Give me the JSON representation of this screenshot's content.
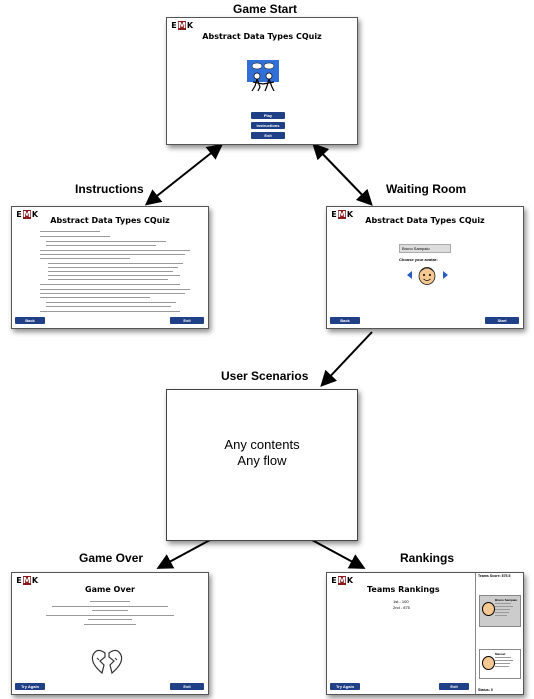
{
  "labels": {
    "game_start": "Game Start",
    "instructions": "Instructions",
    "waiting_room": "Waiting Room",
    "user_scenarios": "User Scenarios",
    "game_over": "Game Over",
    "rankings": "Rankings"
  },
  "logo": {
    "left": "E",
    "middle": "M",
    "right": "K"
  },
  "game_start": {
    "title": "Abstract Data Types CQuiz",
    "buttons": [
      "Play",
      "Instructions",
      "Exit"
    ]
  },
  "instructions": {
    "title": "Abstract Data Types CQuiz",
    "back": "Back",
    "exit": "Exit"
  },
  "waiting_room": {
    "title": "Abstract Data Types CQuiz",
    "name_value": "Bruno Sampaio",
    "avatar_label": "Choose your avatar:",
    "back": "Back",
    "start": "Start"
  },
  "user_scenarios": {
    "line1": "Any contents",
    "line2": "Any flow"
  },
  "game_over": {
    "title": "Game Over",
    "try_again": "Try Again",
    "exit": "Exit"
  },
  "rankings": {
    "title": "Teams Rankings",
    "rank1": "1st - 100",
    "rank2": "2nd - 875",
    "team_score": "Teams Score: 875.5",
    "player1": "Bruno Sampaio",
    "player2": "Manuel",
    "status": "Status: 0",
    "try_again": "Try Again",
    "exit": "Exit"
  }
}
